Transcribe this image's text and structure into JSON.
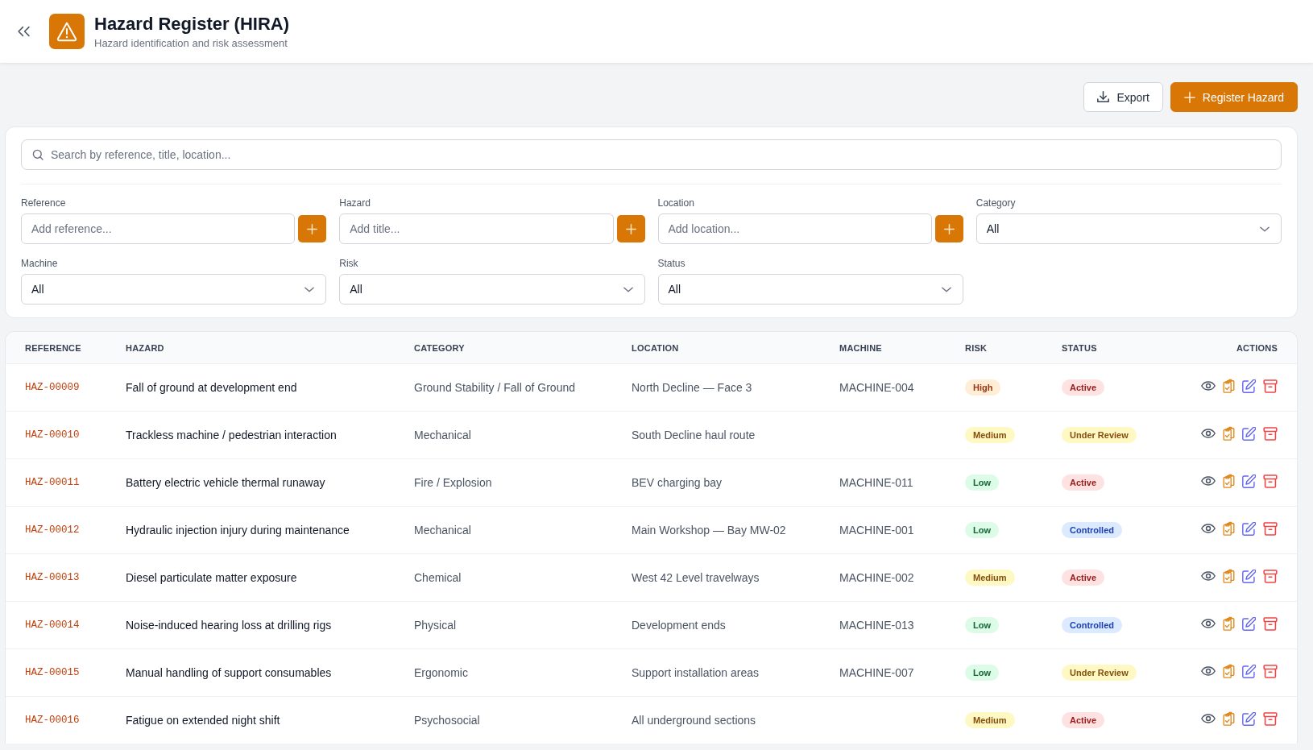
{
  "header": {
    "title": "Hazard Register (HIRA)",
    "subtitle": "Hazard identification and risk assessment"
  },
  "toolbar": {
    "buttons": [
      {
        "kind": "secondary",
        "label": "Export"
      },
      {
        "kind": "primary",
        "label": "Register Hazard"
      }
    ]
  },
  "search": {
    "placeholder": "Search by reference, title, location..."
  },
  "filters": [
    {
      "kind": "add",
      "label": "Reference",
      "placeholder": "Add reference..."
    },
    {
      "kind": "add",
      "label": "Hazard",
      "placeholder": "Add title..."
    },
    {
      "kind": "add",
      "label": "Location",
      "placeholder": "Add location..."
    },
    {
      "kind": "select",
      "label": "Category",
      "value": "All"
    },
    {
      "kind": "select",
      "label": "Machine",
      "value": "All"
    },
    {
      "kind": "select",
      "label": "Risk",
      "value": "All"
    },
    {
      "kind": "select",
      "label": "Status",
      "value": "All"
    }
  ],
  "table": {
    "columns": [
      "REFERENCE",
      "HAZARD",
      "CATEGORY",
      "LOCATION",
      "MACHINE",
      "RISK",
      "STATUS",
      "ACTIONS"
    ],
    "rows": [
      {
        "reference": "HAZ-00009",
        "hazard": "Fall of ground at development end",
        "category": "Ground Stability / Fall of Ground",
        "location": "North Decline — Face 3",
        "machine": "MACHINE-004",
        "risk": {
          "label": "High",
          "kind": "high"
        },
        "status": {
          "label": "Active",
          "kind": "active"
        }
      },
      {
        "reference": "HAZ-00010",
        "hazard": "Trackless machine / pedestrian interaction",
        "category": "Mechanical",
        "location": "South Decline haul route",
        "risk": {
          "label": "Medium",
          "kind": "medium"
        },
        "status": {
          "label": "Under Review",
          "kind": "review"
        }
      },
      {
        "reference": "HAZ-00011",
        "hazard": "Battery electric vehicle thermal runaway",
        "category": "Fire / Explosion",
        "location": "BEV charging bay",
        "machine": "MACHINE-011",
        "risk": {
          "label": "Low",
          "kind": "low"
        },
        "status": {
          "label": "Active",
          "kind": "active"
        }
      },
      {
        "reference": "HAZ-00012",
        "hazard": "Hydraulic injection injury during maintenance",
        "category": "Mechanical",
        "location": "Main Workshop — Bay MW-02",
        "machine": "MACHINE-001",
        "risk": {
          "label": "Low",
          "kind": "low"
        },
        "status": {
          "label": "Controlled",
          "kind": "controlled"
        }
      },
      {
        "reference": "HAZ-00013",
        "hazard": "Diesel particulate matter exposure",
        "category": "Chemical",
        "location": "West 42 Level travelways",
        "machine": "MACHINE-002",
        "risk": {
          "label": "Medium",
          "kind": "medium"
        },
        "status": {
          "label": "Active",
          "kind": "active"
        }
      },
      {
        "reference": "HAZ-00014",
        "hazard": "Noise-induced hearing loss at drilling rigs",
        "category": "Physical",
        "location": "Development ends",
        "machine": "MACHINE-013",
        "risk": {
          "label": "Low",
          "kind": "low"
        },
        "status": {
          "label": "Controlled",
          "kind": "controlled"
        }
      },
      {
        "reference": "HAZ-00015",
        "hazard": "Manual handling of support consumables",
        "category": "Ergonomic",
        "location": "Support installation areas",
        "machine": "MACHINE-007",
        "risk": {
          "label": "Low",
          "kind": "low"
        },
        "status": {
          "label": "Under Review",
          "kind": "review"
        }
      },
      {
        "reference": "HAZ-00016",
        "hazard": "Fatigue on extended night shift",
        "category": "Psychosocial",
        "location": "All underground sections",
        "risk": {
          "label": "Medium",
          "kind": "medium"
        },
        "status": {
          "label": "Active",
          "kind": "active"
        }
      }
    ]
  }
}
